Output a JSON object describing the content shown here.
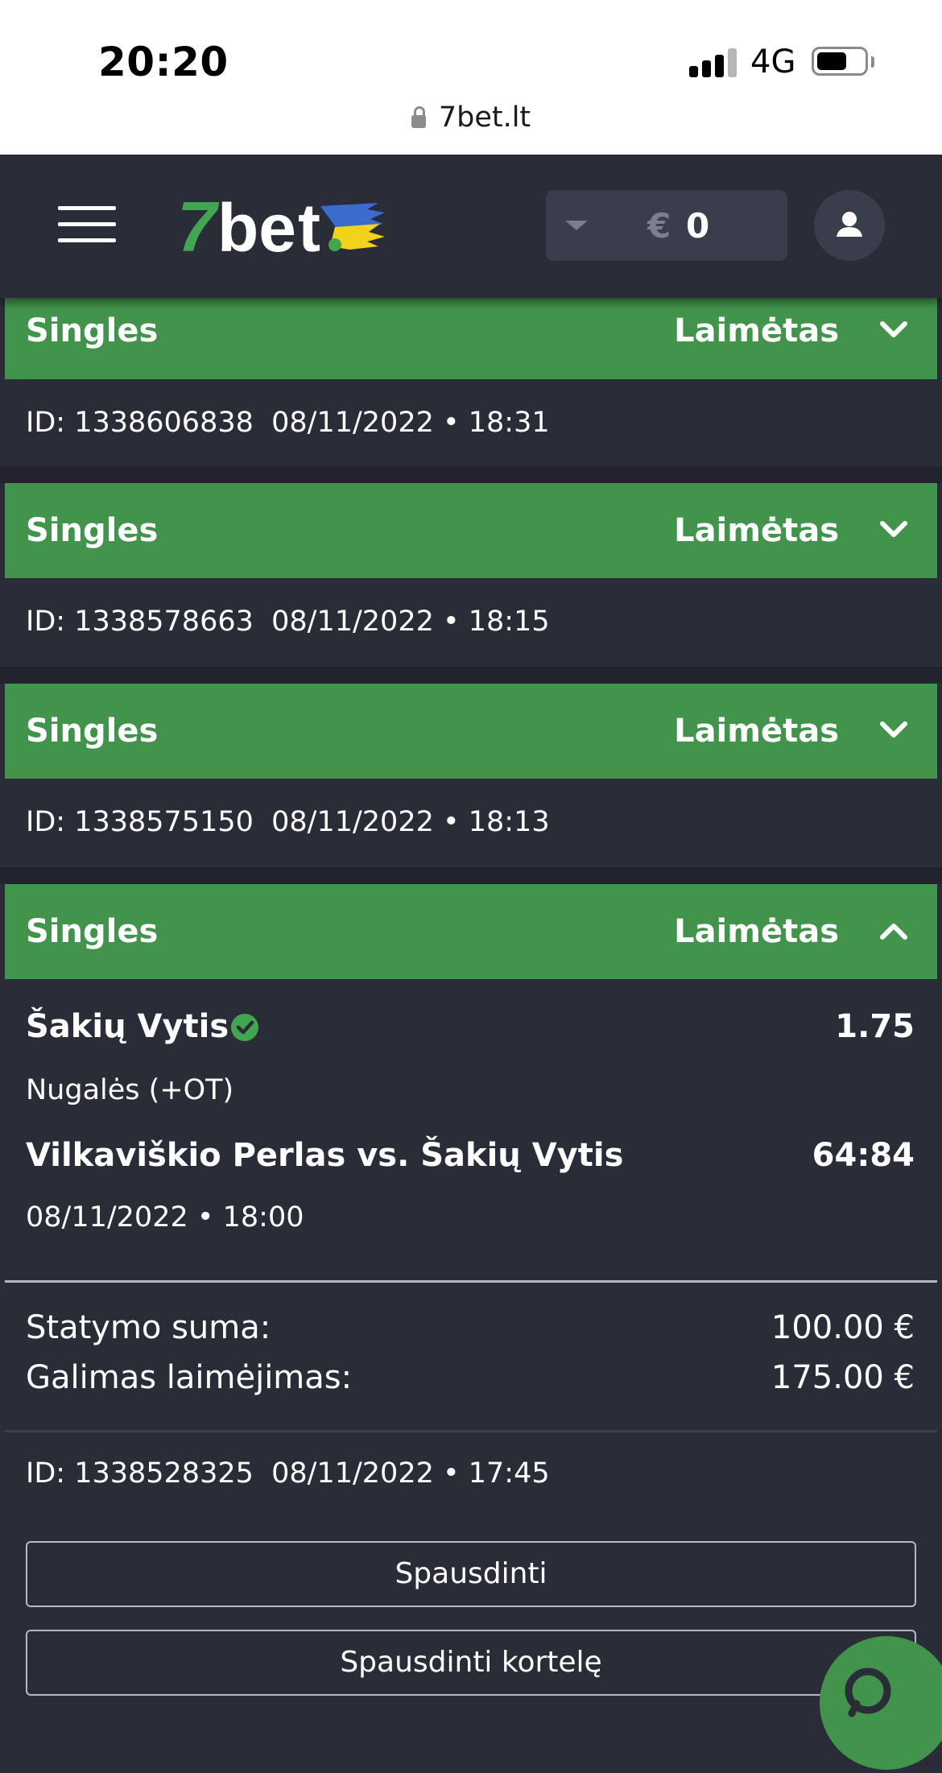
{
  "status_bar": {
    "time": "20:20",
    "network": "4G",
    "url": "7bet.lt"
  },
  "header": {
    "brand": "7bet",
    "balance_currency": "€",
    "balance_amount": "0"
  },
  "bets": [
    {
      "type": "Singles",
      "status": "Laimėtas",
      "id_line": "ID: 1338606838  08/11/2022 • 18:31",
      "expanded": false
    },
    {
      "type": "Singles",
      "status": "Laimėtas",
      "id_line": "ID: 1338578663  08/11/2022 • 18:15",
      "expanded": false
    },
    {
      "type": "Singles",
      "status": "Laimėtas",
      "id_line": "ID: 1338575150  08/11/2022 • 18:13",
      "expanded": false
    },
    {
      "type": "Singles",
      "status": "Laimėtas",
      "expanded": true,
      "selection": {
        "name": "Šakių Vytis",
        "odds": "1.75",
        "market": "Nugalės (+OT)",
        "match": "Vilkaviškio Perlas vs. Šakių Vytis",
        "score": "64:84",
        "date": "08/11/2022 • 18:00"
      },
      "stake_label": "Statymo suma:",
      "stake_value": "100.00 €",
      "win_label": "Galimas laimėjimas:",
      "win_value": "175.00 €",
      "id_line": "ID: 1338528325  08/11/2022 • 17:45",
      "print_label": "Spausdinti",
      "print_card_label": "Spausdinti kortelę"
    }
  ],
  "colors": {
    "accent_green": "#42944c",
    "background": "#2a2c38",
    "header_bg": "#2a2c38",
    "panel": "#3a3d4c"
  }
}
